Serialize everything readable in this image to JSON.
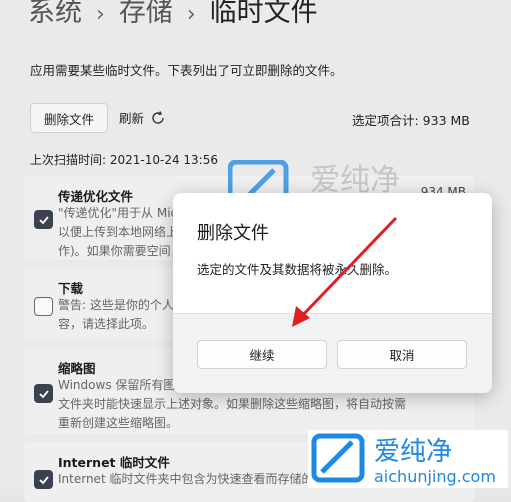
{
  "breadcrumb": {
    "item1": "系统",
    "item2": "存储",
    "current": "临时文件",
    "separator": "›"
  },
  "description": "应用需要某些临时文件。下表列出了可立即删除的文件。",
  "toolbar": {
    "delete_files": "删除文件",
    "refresh": "刷新",
    "total": "选定项合计: 933 MB"
  },
  "last_scan": "上次扫描时间: 2021-10-24 13:56",
  "items": [
    {
      "title": "传递优化文件",
      "size": "934 MB",
      "checked": true,
      "lines": [
        "\"传递优化\"用于从 Microsoft 下载更新的文件。",
        "以便上传到本地网络上的其他设备，帮助更快地更新设",
        "作)。如果你需要空间，可以删除这些文件。"
      ]
    },
    {
      "title": "下载",
      "checked": false,
      "lines": [
        "警告: 这些是你的个人下载文件夹中的文件。如果你想删除",
        "容，请选择此项。"
      ]
    },
    {
      "title": "缩略图",
      "checked": true,
      "lines": [
        "Windows 保留所有图片、视频和文档文件的缩略图副本，以便在打开",
        "文件夹时能快速显示上述对象。如果删除这些缩略图，将自动按需",
        "重新创建这些缩略图。"
      ]
    },
    {
      "title": "Internet 临时文件",
      "checked": true,
      "lines": [
        "Internet 临时文件夹中包含为快速查看而存储的网页。"
      ]
    }
  ],
  "dialog": {
    "title": "删除文件",
    "message": "选定的文件及其数据将被永久删除。",
    "continue": "继续",
    "cancel": "取消"
  },
  "watermark": {
    "brand": "爱纯净",
    "url": "aichunjing.com"
  },
  "colors": {
    "accent_check": "#3a4150",
    "arrow": "#e02020",
    "watermark_blue": "#1e88e5"
  }
}
